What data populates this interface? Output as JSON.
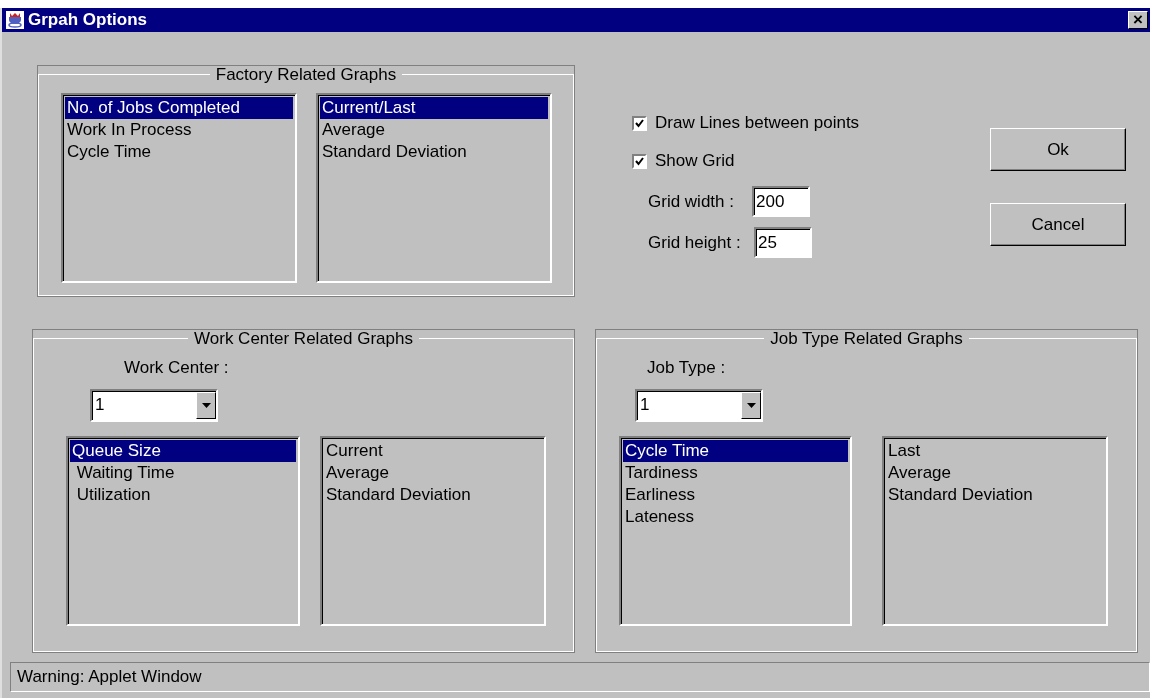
{
  "window": {
    "title": "Grpah Options",
    "close": "×"
  },
  "factory": {
    "title": "Factory Related Graphs",
    "graphs": [
      {
        "label": "No. of Jobs Completed",
        "selected": true
      },
      {
        "label": "Work In Process",
        "selected": false
      },
      {
        "label": "Cycle Time",
        "selected": false
      }
    ],
    "stats": [
      {
        "label": "Current/Last",
        "selected": true
      },
      {
        "label": "Average",
        "selected": false
      },
      {
        "label": "Standard Deviation",
        "selected": false
      }
    ]
  },
  "options": [
    {
      "label": "Draw Lines between points",
      "checked": true
    },
    {
      "label": "Show Grid",
      "checked": true
    }
  ],
  "grid_fields": [
    {
      "label": "Grid width :",
      "value": "200"
    },
    {
      "label": "Grid height :",
      "value": "25"
    }
  ],
  "buttons": [
    "Ok",
    "Cancel"
  ],
  "work_center": {
    "title": "Work Center Related Graphs",
    "selector_label": "Work Center :",
    "selector_value": "1",
    "graphs": [
      {
        "label": "Queue Size",
        "selected": true
      },
      {
        "label": " Waiting Time",
        "selected": false
      },
      {
        "label": " Utilization",
        "selected": false
      }
    ],
    "stats": [
      {
        "label": "Current",
        "selected": false
      },
      {
        "label": "Average",
        "selected": false
      },
      {
        "label": "Standard Deviation",
        "selected": false
      }
    ]
  },
  "job_type": {
    "title": "Job Type Related Graphs",
    "selector_label": "Job Type :",
    "selector_value": "1",
    "graphs": [
      {
        "label": "Cycle Time",
        "selected": true
      },
      {
        "label": "Tardiness",
        "selected": false
      },
      {
        "label": "Earliness",
        "selected": false
      },
      {
        "label": "Lateness",
        "selected": false
      }
    ],
    "stats": [
      {
        "label": "Last",
        "selected": false
      },
      {
        "label": "Average",
        "selected": false
      },
      {
        "label": "Standard Deviation",
        "selected": false
      }
    ]
  },
  "status_bar": "Warning: Applet Window"
}
